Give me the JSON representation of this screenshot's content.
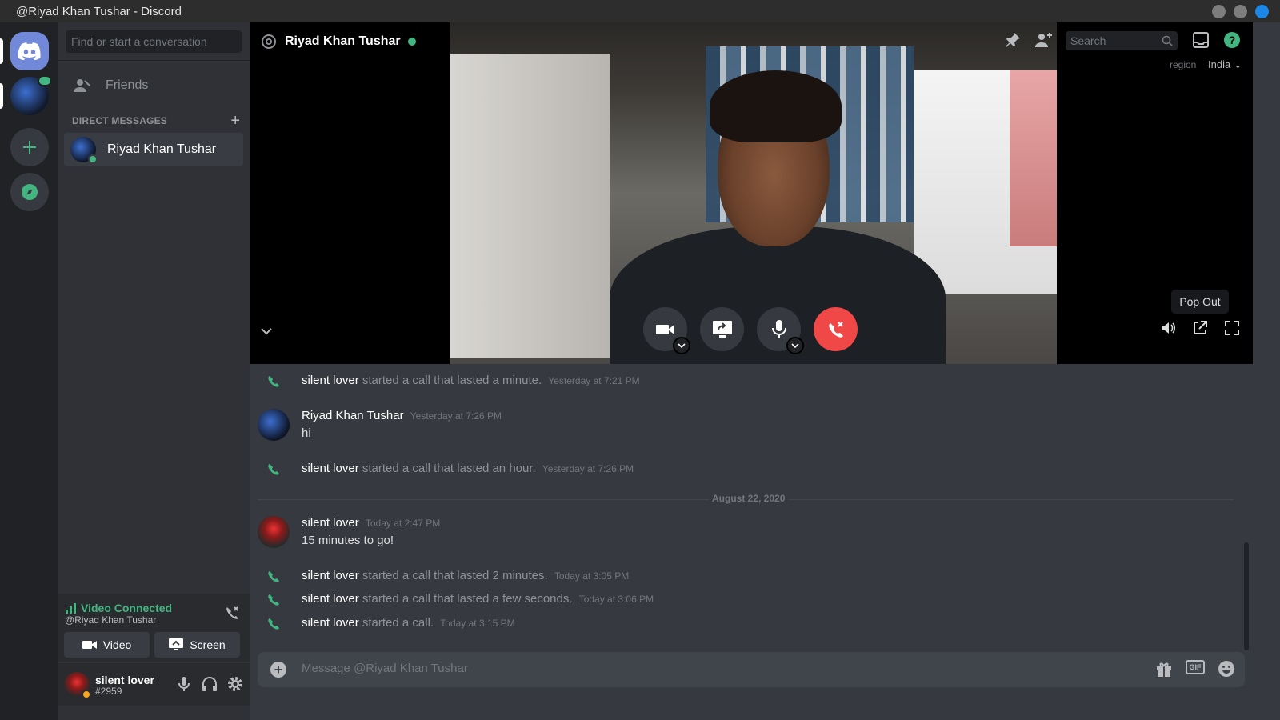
{
  "window": {
    "title": "@Riyad Khan Tushar - Discord"
  },
  "sidebar": {
    "search_placeholder": "Find or start a conversation",
    "friends_label": "Friends",
    "dm_header": "DIRECT MESSAGES",
    "dm_items": [
      {
        "label": "Riyad Khan Tushar"
      }
    ]
  },
  "voice": {
    "status": "Video Connected",
    "target": "@Riyad Khan Tushar",
    "video_label": "Video",
    "screen_label": "Screen"
  },
  "user": {
    "name": "silent lover",
    "tag": "#2959"
  },
  "call": {
    "header_name": "Riyad Khan Tushar",
    "search_placeholder": "Search",
    "region_label": "region",
    "region_value": "India",
    "popout_tooltip": "Pop Out"
  },
  "messages": [
    {
      "type": "call",
      "author": "silent lover",
      "text": "started a call that lasted a minute.",
      "time": "Yesterday at 7:21 PM"
    },
    {
      "type": "msg",
      "author": "Riyad Khan Tushar",
      "time": "Yesterday at 7:26 PM",
      "text": "hi"
    },
    {
      "type": "call",
      "author": "silent lover",
      "text": "started a call that lasted an hour.",
      "time": "Yesterday at 7:26 PM"
    },
    {
      "type": "date",
      "text": "August 22, 2020"
    },
    {
      "type": "msg",
      "author": "silent lover",
      "time": "Today at 2:47 PM",
      "text": "15 minutes to go!"
    },
    {
      "type": "call",
      "author": "silent lover",
      "text": "started a call that lasted 2 minutes.",
      "time": "Today at 3:05 PM"
    },
    {
      "type": "call",
      "author": "silent lover",
      "text": "started a call that lasted a few seconds.",
      "time": "Today at 3:06 PM"
    },
    {
      "type": "call",
      "author": "silent lover",
      "text": "started a call.",
      "time": "Today at 3:15 PM"
    }
  ],
  "composer": {
    "placeholder": "Message @Riyad Khan Tushar",
    "gif_label": "GIF"
  },
  "colors": {
    "accent": "#7289da",
    "online": "#43b581",
    "danger": "#f04747",
    "idle": "#faa61a"
  }
}
